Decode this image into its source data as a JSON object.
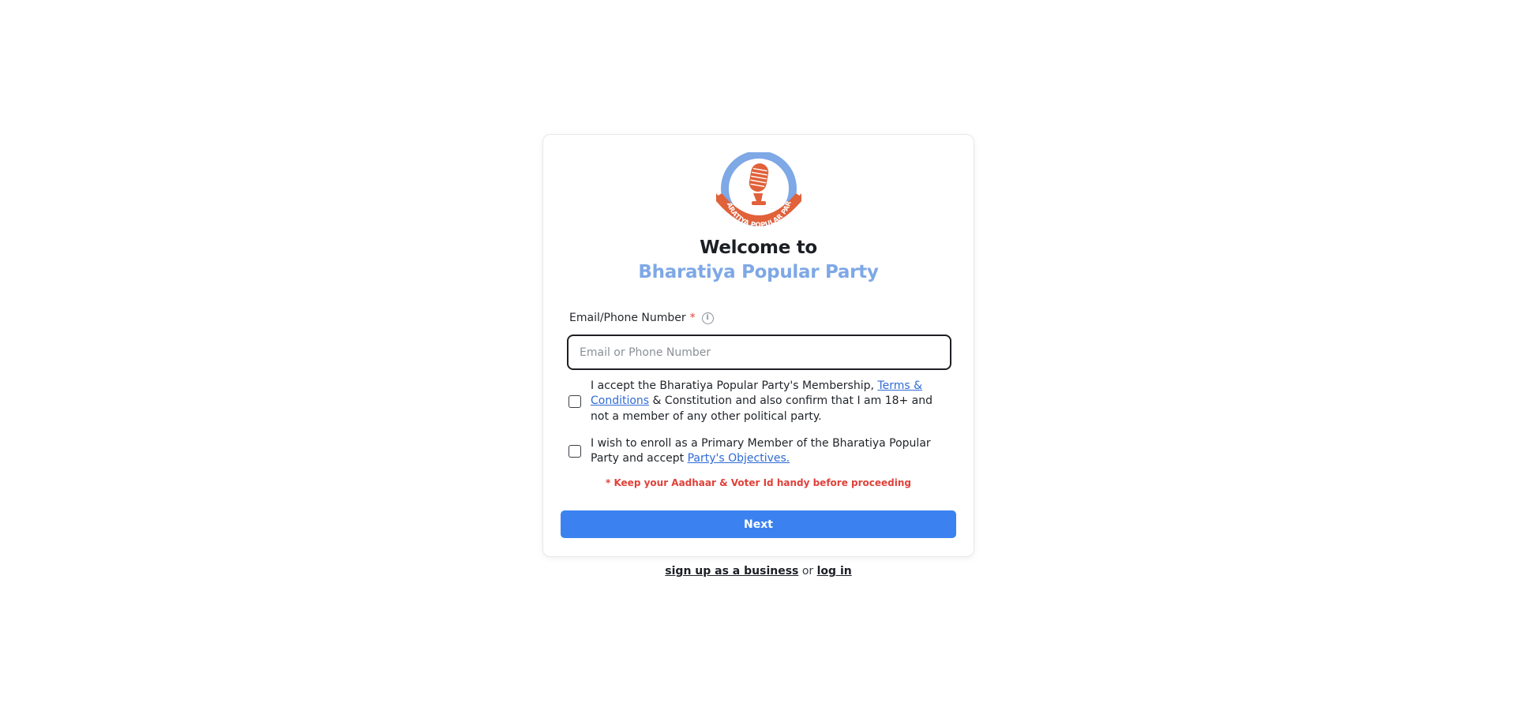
{
  "logo": {
    "text": "BHARATIYA POPULAR PARTY",
    "icon": "microphone-icon",
    "colors": {
      "ring": "#7ea8e6",
      "emblem": "#e0613a"
    }
  },
  "heading": {
    "welcome": "Welcome to",
    "brand": "Bharatiya Popular Party"
  },
  "form": {
    "email_label": "Email/Phone Number",
    "required_mark": "*",
    "info_icon": "i",
    "email_placeholder": "Email or Phone Number",
    "email_value": ""
  },
  "consent": {
    "terms": {
      "text_before": "I accept the Bharatiya Popular Party's Membership, ",
      "link": "Terms & Conditions",
      "text_after": " & Constitution and also confirm that I am 18+ and not a member of any other political party.",
      "checked": false
    },
    "membership": {
      "text_before": "I wish to enroll as a Primary Member of the Bharatiya Popular Party and accept ",
      "link": "Party's Objectives.",
      "checked": false
    }
  },
  "note": "* Keep your Aadhaar & Voter Id handy before proceeding",
  "actions": {
    "next_label": "Next"
  },
  "footer": {
    "business_link": "sign up as a business",
    "or": "or",
    "login_link": "log in"
  },
  "colors": {
    "primary_button": "#3b82f0",
    "brand_blue": "#7ea8e6",
    "warning_red": "#e0413a",
    "link_blue": "#2f6bd6"
  }
}
